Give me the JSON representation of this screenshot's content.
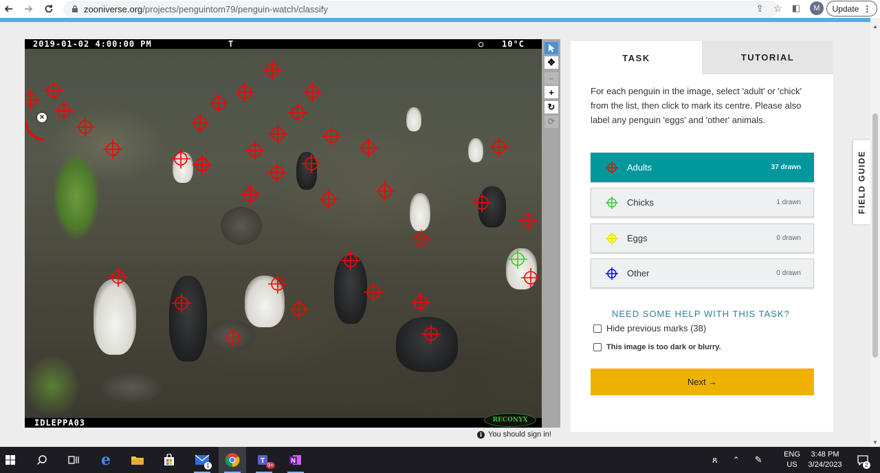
{
  "browser": {
    "url_host": "zooniverse.org",
    "url_path": "/projects/penguintom79/penguin-watch/classify",
    "avatar_letter": "M",
    "update_label": "Update"
  },
  "camera": {
    "datetime": "2019-01-02 4:00:00 PM",
    "flag": "T",
    "moon": "○",
    "temperature": "10°C",
    "camera_id": "IDLEPPA03",
    "brand": "RECONYX"
  },
  "image_tools": [
    {
      "name": "pointer-icon",
      "glyph": "➤"
    },
    {
      "name": "move-icon",
      "glyph": "✥"
    },
    {
      "name": "zoom-out-icon",
      "glyph": "−"
    },
    {
      "name": "zoom-in-icon",
      "glyph": "+"
    },
    {
      "name": "rotate-icon",
      "glyph": "↻"
    },
    {
      "name": "reset-icon",
      "glyph": "⟳"
    }
  ],
  "signin_notice": "You should sign in!",
  "task_panel": {
    "tabs": {
      "task": "TASK",
      "tutorial": "TUTORIAL"
    },
    "instructions": "For each penguin in the image, select 'adult' or 'chick' from the list, then click to mark its centre. Please also label any penguin 'eggs' and 'other' animals.",
    "tools": [
      {
        "label": "Adults",
        "count": "37 drawn",
        "color": "#ff0000",
        "active": true
      },
      {
        "label": "Chicks",
        "count": "1 drawn",
        "color": "#33cc33",
        "active": false
      },
      {
        "label": "Eggs",
        "count": "0 drawn",
        "color": "#ffff00",
        "active": false
      },
      {
        "label": "Other",
        "count": "0 drawn",
        "color": "#0000ff",
        "active": false
      }
    ],
    "help_link": "NEED SOME HELP WITH THIS TASK?",
    "hide_marks_label": "Hide previous marks (38)",
    "dark_image_label": "This image is too dark or blurry.",
    "next_label": "Next →"
  },
  "field_guide_label": "FIELD GUIDE",
  "taskbar": {
    "mail_badge": "1",
    "teams_badge": "9+",
    "lang_top": "ENG",
    "lang_bottom": "US",
    "time": "3:48 PM",
    "date": "3/24/2023",
    "notif_count": "2"
  },
  "colors": {
    "accent_teal": "#00979d",
    "next_button": "#f0b200",
    "brand_bar": "#4fb0e0",
    "adult_mark": "#ff0000",
    "chick_mark": "#33cc33"
  }
}
